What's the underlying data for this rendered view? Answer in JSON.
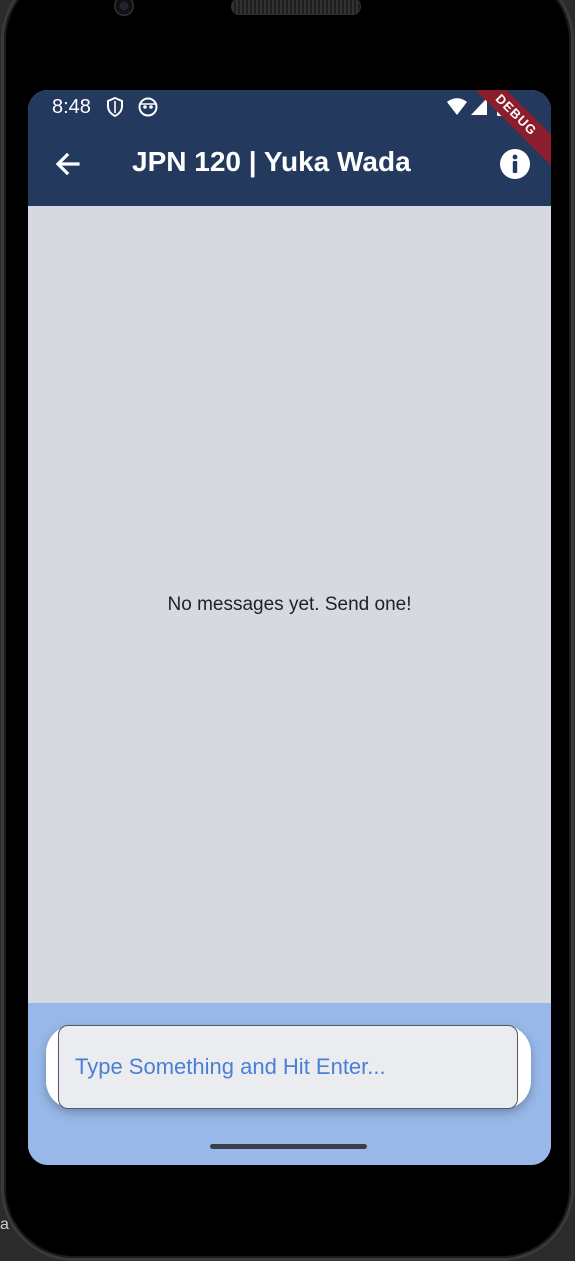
{
  "status_bar": {
    "time": "8:48",
    "left_icons": [
      "shield-icon",
      "android-head-icon"
    ],
    "right_icons": [
      "wifi-icon",
      "signal-icon",
      "battery-icon"
    ],
    "background": "#233a5e"
  },
  "app_bar": {
    "back_icon": "arrow-back-icon",
    "title": "JPN 120 | Yuka Wada",
    "info_icon": "info-icon",
    "background": "#233a5e"
  },
  "debug_banner": {
    "label": "DEBUG",
    "color": "#8b1d2c"
  },
  "chat": {
    "empty_message": "No messages yet. Send one!",
    "background": "#d6d9e0"
  },
  "composer": {
    "placeholder": "Type Something and Hit Enter...",
    "value": "",
    "background": "#97b8e8",
    "placeholder_color": "#4a7fd6"
  },
  "edge_fragment": "a"
}
